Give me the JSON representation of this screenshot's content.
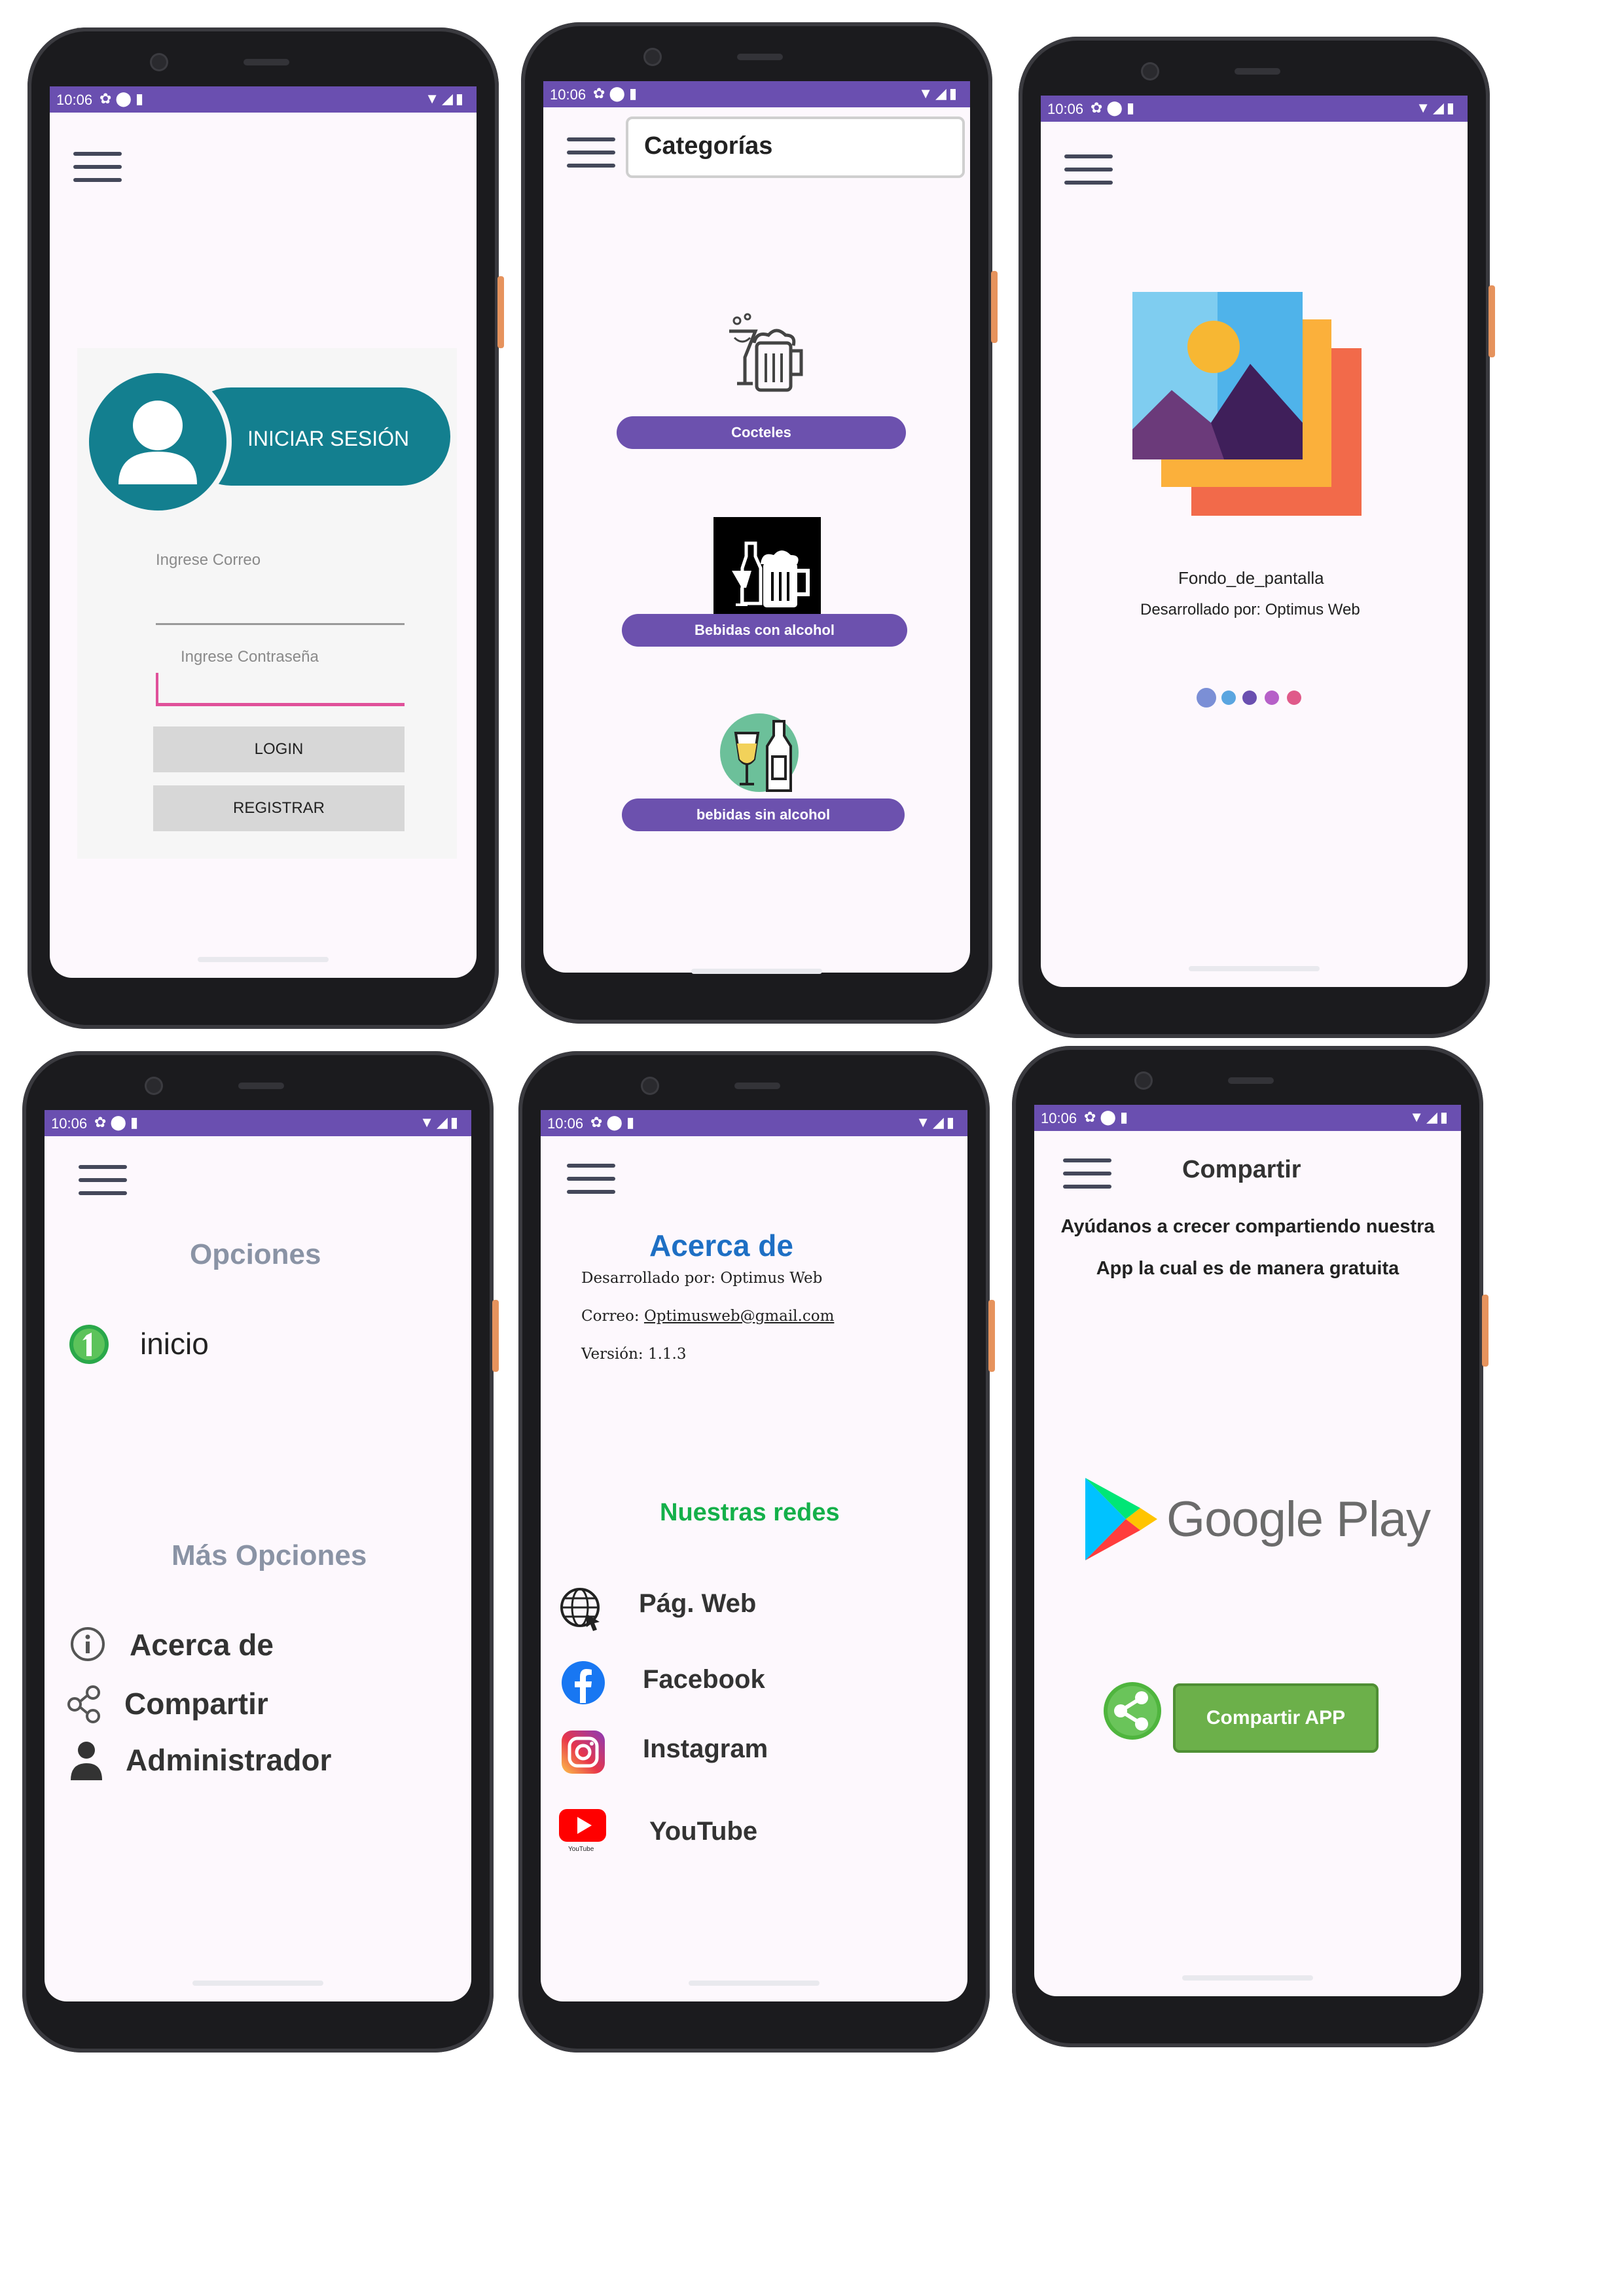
{
  "status": {
    "time": "10:06"
  },
  "login": {
    "title": "INICIAR SESIÓN",
    "email_placeholder": "Ingrese Correo",
    "password_placeholder": "Ingrese Contraseña",
    "login_label": "LOGIN",
    "register_label": "REGISTRAR"
  },
  "categories": {
    "search_value": "Categorías",
    "items": [
      {
        "label": "Cocteles",
        "icon": "cocktail-beer-icon"
      },
      {
        "label": "Bebidas con alcohol",
        "icon": "alcohol-drinks-icon"
      },
      {
        "label": "bebidas sin alcohol",
        "icon": "soft-drinks-icon"
      }
    ]
  },
  "splash": {
    "app_name": "Fondo_de_pantalla",
    "developer": "Desarrollado por: Optimus Web",
    "dot_colors": [
      "#7b8fd6",
      "#5aa5e0",
      "#6a4fb0",
      "#b660c8",
      "#e05a8a"
    ]
  },
  "drawer": {
    "section1": "Opciones",
    "home": "inicio",
    "section2": "Más Opciones",
    "items": [
      "Acerca de",
      "Compartir",
      "Administrador"
    ]
  },
  "about": {
    "title": "Acerca de",
    "developer": "Desarrollado por: Optimus Web",
    "email_label": "Correo: ",
    "email": "Optimusweb@gmail.com",
    "version": "Versión: 1.1.3",
    "networks_title": "Nuestras redes",
    "networks": [
      "Pág. Web",
      "Facebook",
      "Instagram",
      "YouTube"
    ],
    "youtube_caption": "YouTube"
  },
  "share": {
    "title": "Compartir",
    "line1": "Ayúdanos a crecer compartiendo nuestra",
    "line2": "App la cual es de manera gratuita",
    "store": "Google Play",
    "button": "Compartir APP"
  },
  "colors": {
    "accent": "#6a4fb0",
    "teal": "#137f8f",
    "about_blue": "#1e6fc4",
    "green_title": "#14b04a",
    "share_green": "#6cb04a"
  }
}
